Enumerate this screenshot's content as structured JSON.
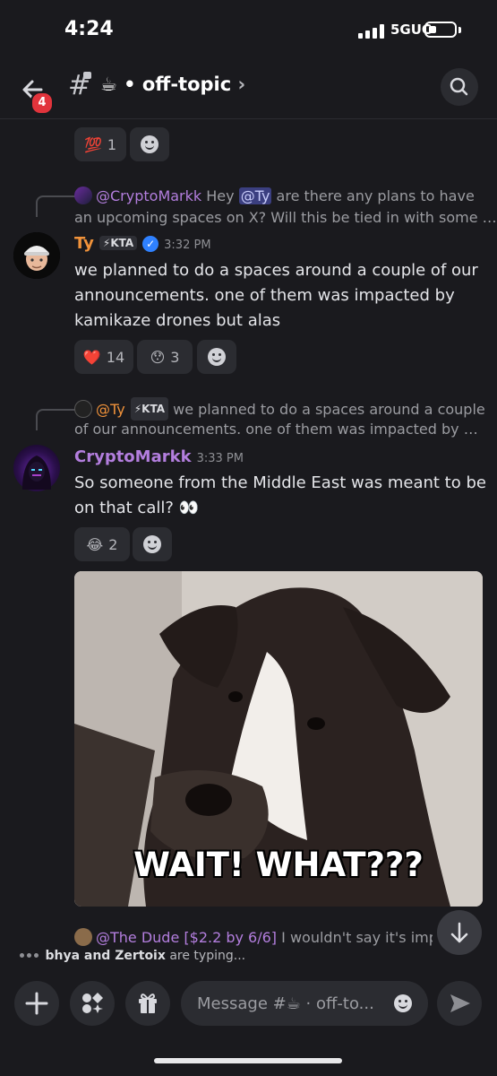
{
  "status_bar": {
    "time": "4:24",
    "network": "5GUC"
  },
  "header": {
    "back_badge": "4",
    "channel_emoji": "☕",
    "channel_name": "• off-topic",
    "chevron": "›"
  },
  "top_reactions": [
    {
      "emoji": "💯",
      "count": "1"
    }
  ],
  "messages": [
    {
      "reply": {
        "author": "@CryptoMarkk",
        "text_before": "Hey",
        "mention": "@Ty",
        "text_after": "are there any plans to have",
        "line2": "an upcoming spaces on X? Will this be tied in with some …"
      },
      "author": "Ty",
      "author_color": "#f0923a",
      "tag": "⚡KTA",
      "time": "3:32 PM",
      "lines": [
        "we planned to do a spaces around a couple of our",
        "announcements. one of them was impacted by",
        "kamikaze drones but alas"
      ],
      "reactions": [
        {
          "emoji": "❤️",
          "count": "14"
        },
        {
          "emoji": "😯",
          "count": "3"
        }
      ]
    },
    {
      "reply": {
        "author": "@Ty",
        "tag": "⚡KTA",
        "text": "we planned to do a spaces around a couple",
        "line2": "of our announcements. one of them was impacted by …"
      },
      "author": "CryptoMarkk",
      "author_color": "#b37ede",
      "time": "3:33 PM",
      "lines": [
        "So someone from the Middle East was meant to be",
        "on that call? 👀"
      ],
      "reactions": [
        {
          "emoji": "😂",
          "count": "2"
        }
      ],
      "gif_caption": "WAIT! WHAT???"
    }
  ],
  "partial_reply": {
    "author": "@The Dude [$2.2 by 6/6]",
    "text": "I wouldn't say it's impro…"
  },
  "typing": {
    "users": "bhya and Zertoix",
    "suffix": "are typing..."
  },
  "composer": {
    "placeholder": "Message #☕ · off-to..."
  }
}
